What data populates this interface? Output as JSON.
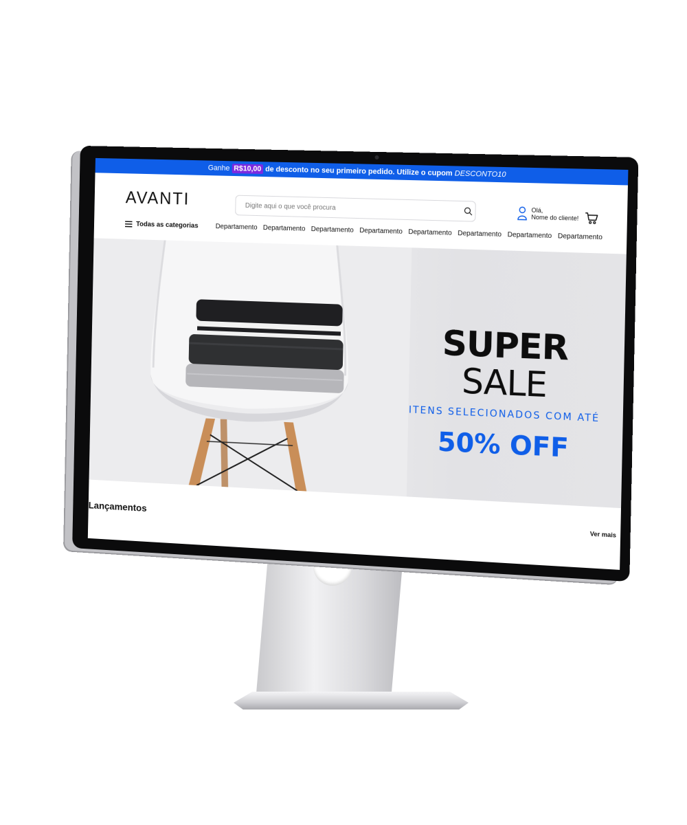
{
  "promo": {
    "prefix": "Ganhe",
    "amount": "R$10,00",
    "middle": "de desconto no seu primeiro pedido. Utilize o cupom",
    "coupon": "DESCONTO10"
  },
  "header": {
    "logo": "AVANTI",
    "search_placeholder": "Digite aqui o que você procura",
    "account_greeting": "Olá,",
    "account_name": "Nome do cliente!"
  },
  "nav": {
    "all_categories": "Todas as categorias",
    "departments": [
      "Departamento",
      "Departamento",
      "Departamento",
      "Departamento",
      "Departamento",
      "Departamento",
      "Departamento",
      "Departamento"
    ]
  },
  "hero": {
    "title_bold": "SUPER",
    "title_light": "SALE",
    "subtitle": "ITENS SELECIONADOS COM ATÉ",
    "offer": "50% OFF"
  },
  "releases": {
    "title": "Lançamentos",
    "see_more": "Ver mais"
  },
  "colors": {
    "brand_blue": "#0f5ee8",
    "coupon_highlight": "#7c2ae0"
  }
}
